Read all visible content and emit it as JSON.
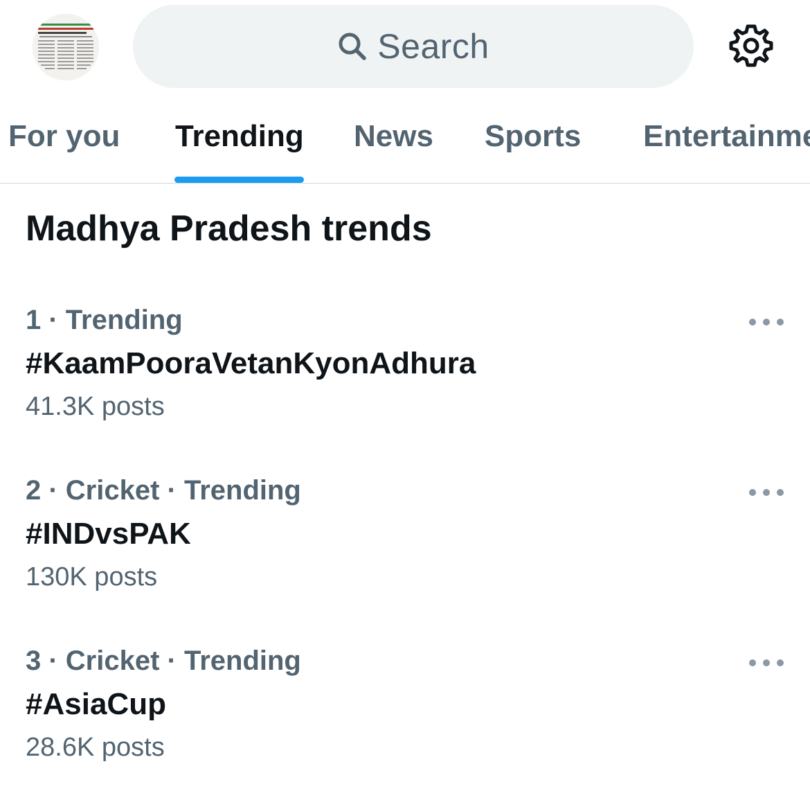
{
  "header": {
    "search_placeholder": "Search",
    "avatar_icon": "newspaper-clipping-avatar",
    "search_icon": "search-icon",
    "settings_icon": "gear-icon"
  },
  "tabs": [
    {
      "label": "For you",
      "active": false
    },
    {
      "label": "Trending",
      "active": true
    },
    {
      "label": "News",
      "active": false
    },
    {
      "label": "Sports",
      "active": false
    },
    {
      "label": "Entertainment",
      "active": false
    }
  ],
  "main": {
    "section_title": "Madhya Pradesh trends",
    "trends": [
      {
        "meta": "1 · Trending",
        "name": "#KaamPooraVetanKyonAdhura",
        "count": "41.3K posts"
      },
      {
        "meta": "2 · Cricket · Trending",
        "name": "#INDvsPAK",
        "count": "130K posts"
      },
      {
        "meta": "3 · Cricket · Trending",
        "name": "#AsiaCup",
        "count": "28.6K posts"
      }
    ]
  },
  "colors": {
    "accent": "#1d9bf0",
    "text_primary": "#0f1419",
    "text_secondary": "#536471",
    "search_bg": "#eff3f4",
    "divider": "#cfd9de"
  }
}
